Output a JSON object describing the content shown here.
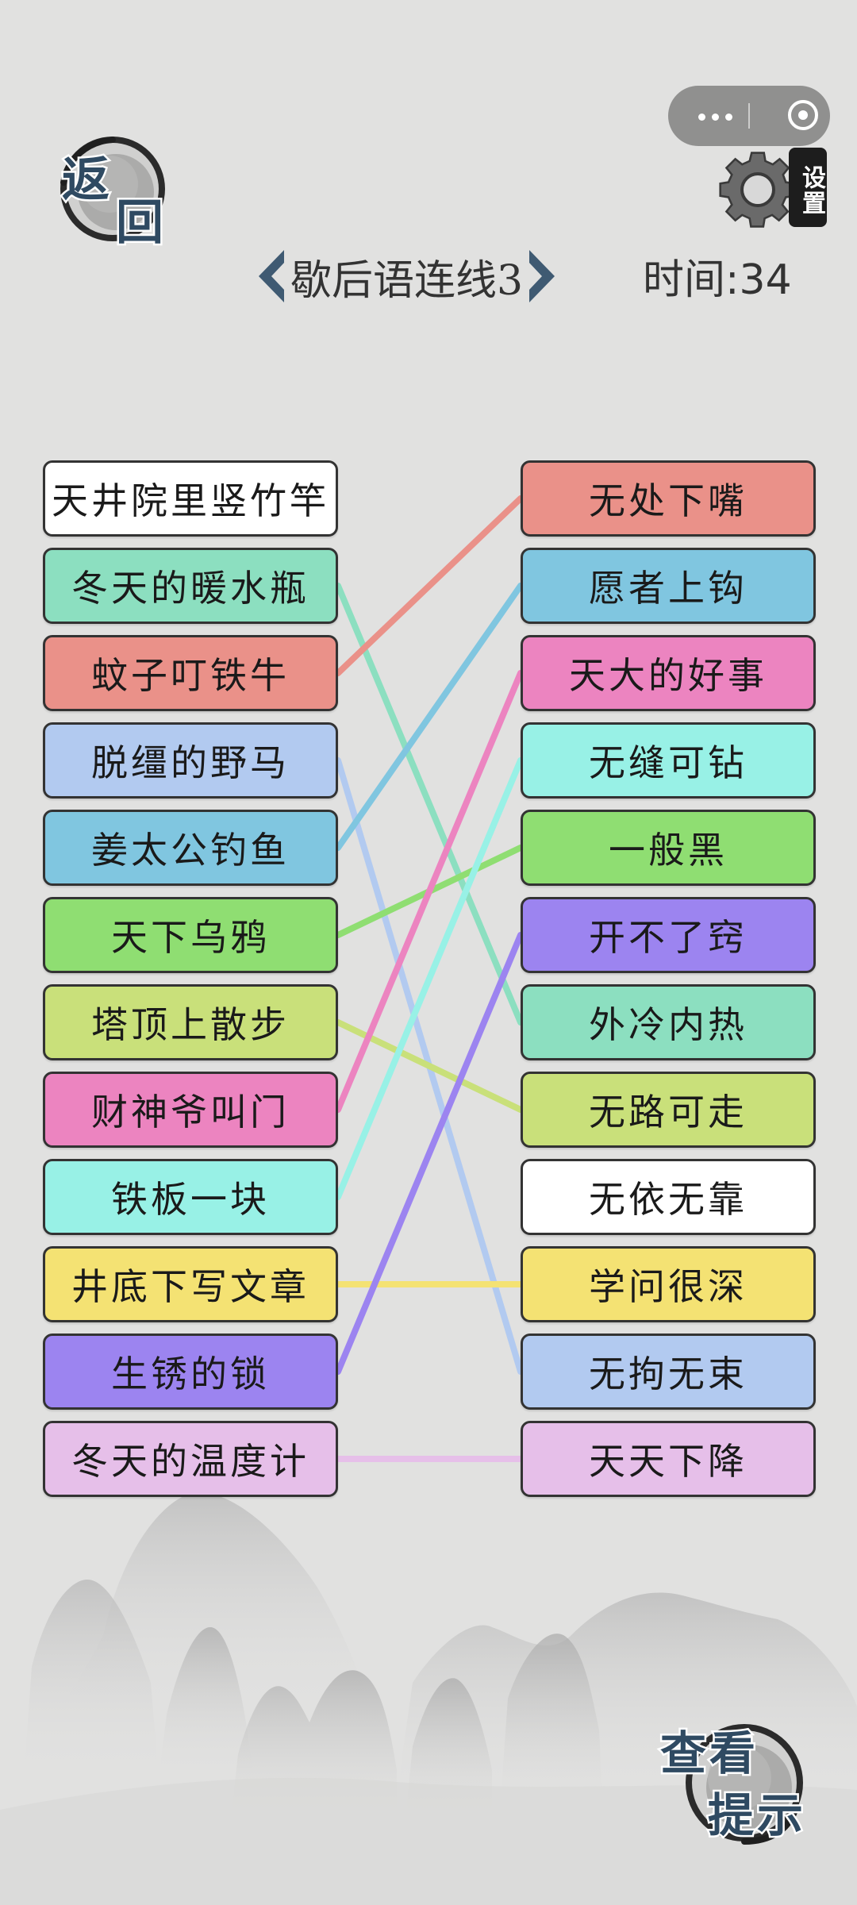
{
  "back_button": {
    "chars": [
      "返",
      "回"
    ]
  },
  "settings_button": {
    "label": "设置"
  },
  "header": {
    "title": "歇后语连线3",
    "timer": "时间:34"
  },
  "left_items": [
    {
      "label": "天井院里竖竹竿",
      "color": "#ffffff"
    },
    {
      "label": "冬天的暖水瓶",
      "color": "#8cdfc0"
    },
    {
      "label": "蚊子叮铁牛",
      "color": "#ea9189"
    },
    {
      "label": "脱缰的野马",
      "color": "#b2caf0"
    },
    {
      "label": "姜太公钓鱼",
      "color": "#80c6e0"
    },
    {
      "label": "天下乌鸦",
      "color": "#8fde72"
    },
    {
      "label": "塔顶上散步",
      "color": "#c9e07a"
    },
    {
      "label": "财神爷叫门",
      "color": "#ec84c0"
    },
    {
      "label": "铁板一块",
      "color": "#98f1e6"
    },
    {
      "label": "井底下写文章",
      "color": "#f4e273"
    },
    {
      "label": "生锈的锁",
      "color": "#9c84f0"
    },
    {
      "label": "冬天的温度计",
      "color": "#e6bfe9"
    }
  ],
  "right_items": [
    {
      "label": "无处下嘴",
      "color": "#ea9189"
    },
    {
      "label": "愿者上钩",
      "color": "#80c6e0"
    },
    {
      "label": "天大的好事",
      "color": "#ec84c0"
    },
    {
      "label": "无缝可钻",
      "color": "#98f1e6"
    },
    {
      "label": "一般黑",
      "color": "#8fde72"
    },
    {
      "label": "开不了窍",
      "color": "#9c84f0"
    },
    {
      "label": "外冷内热",
      "color": "#8cdfc0"
    },
    {
      "label": "无路可走",
      "color": "#c9e07a"
    },
    {
      "label": "无依无靠",
      "color": "#ffffff"
    },
    {
      "label": "学问很深",
      "color": "#f4e273"
    },
    {
      "label": "无拘无束",
      "color": "#b2caf0"
    },
    {
      "label": "天天下降",
      "color": "#e6bfe9"
    }
  ],
  "connections": [
    {
      "from": 1,
      "to": 6,
      "color": "#8cdfc0"
    },
    {
      "from": 2,
      "to": 0,
      "color": "#ea9189"
    },
    {
      "from": 3,
      "to": 10,
      "color": "#b2caf0"
    },
    {
      "from": 4,
      "to": 1,
      "color": "#80c6e0"
    },
    {
      "from": 5,
      "to": 4,
      "color": "#8fde72"
    },
    {
      "from": 6,
      "to": 7,
      "color": "#c9e07a"
    },
    {
      "from": 7,
      "to": 2,
      "color": "#ec84c0"
    },
    {
      "from": 8,
      "to": 3,
      "color": "#98f1e6"
    },
    {
      "from": 9,
      "to": 9,
      "color": "#f4e273"
    },
    {
      "from": 10,
      "to": 5,
      "color": "#9c84f0"
    },
    {
      "from": 11,
      "to": 11,
      "color": "#e6bfe9"
    }
  ],
  "hint_button": {
    "chars": [
      "查",
      "看",
      "提",
      "示"
    ]
  },
  "colors": {
    "background": "#e1e1e0",
    "ink_text": "#2f4a62",
    "arrow": "#3f5a72"
  }
}
